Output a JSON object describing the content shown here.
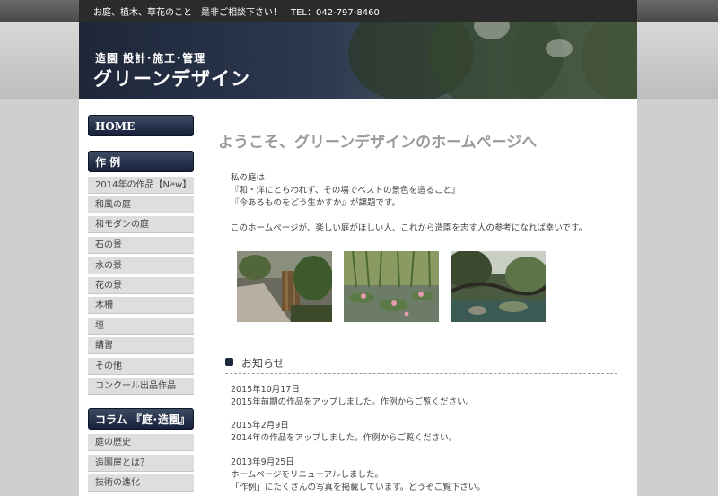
{
  "topbar": {
    "text": "お庭、植木、草花のこと　是非ご相談下さい！　TEL：042-797-8460"
  },
  "header": {
    "subtitle": "造園 設計･施工･管理",
    "title": "グリーンデザイン"
  },
  "sidebar": {
    "home": "HOME",
    "works_title": "作 例",
    "works": [
      "2014年の作品【New】",
      "和風の庭",
      "和モダンの庭",
      "石の景",
      "水の景",
      "花の景",
      "木柵",
      "垣",
      "講習",
      "その他",
      "コンクール出品作品"
    ],
    "column_title": "コラム 『庭･造園』",
    "column": [
      "庭の歴史",
      "造園屋とは？",
      "技術の進化"
    ]
  },
  "main": {
    "welcome": "ようこそ、グリーンデザインのホームページへ",
    "intro": [
      "私の庭は",
      "『和・洋にとらわれず、その場でベストの景色を造ること』",
      "『今あるものをどう生かすか』が課題です。",
      "",
      "このホームページが、楽しい庭がほしい人、これから造園を志す人の参考になれば幸いです。"
    ]
  },
  "news": {
    "title": "お知らせ",
    "items": [
      {
        "date": "2015年10月17日",
        "lines": [
          "2015年前期の作品をアップしました。作例からご覧ください。"
        ]
      },
      {
        "date": "2015年2月9日",
        "lines": [
          "2014年の作品をアップしました。作例からご覧ください。"
        ]
      },
      {
        "date": "2013年9月25日",
        "lines": [
          "ホームページをリニューアルしました。",
          "「作例」にたくさんの写真を掲載しています。どうぞご覧下さい。"
        ]
      }
    ]
  }
}
